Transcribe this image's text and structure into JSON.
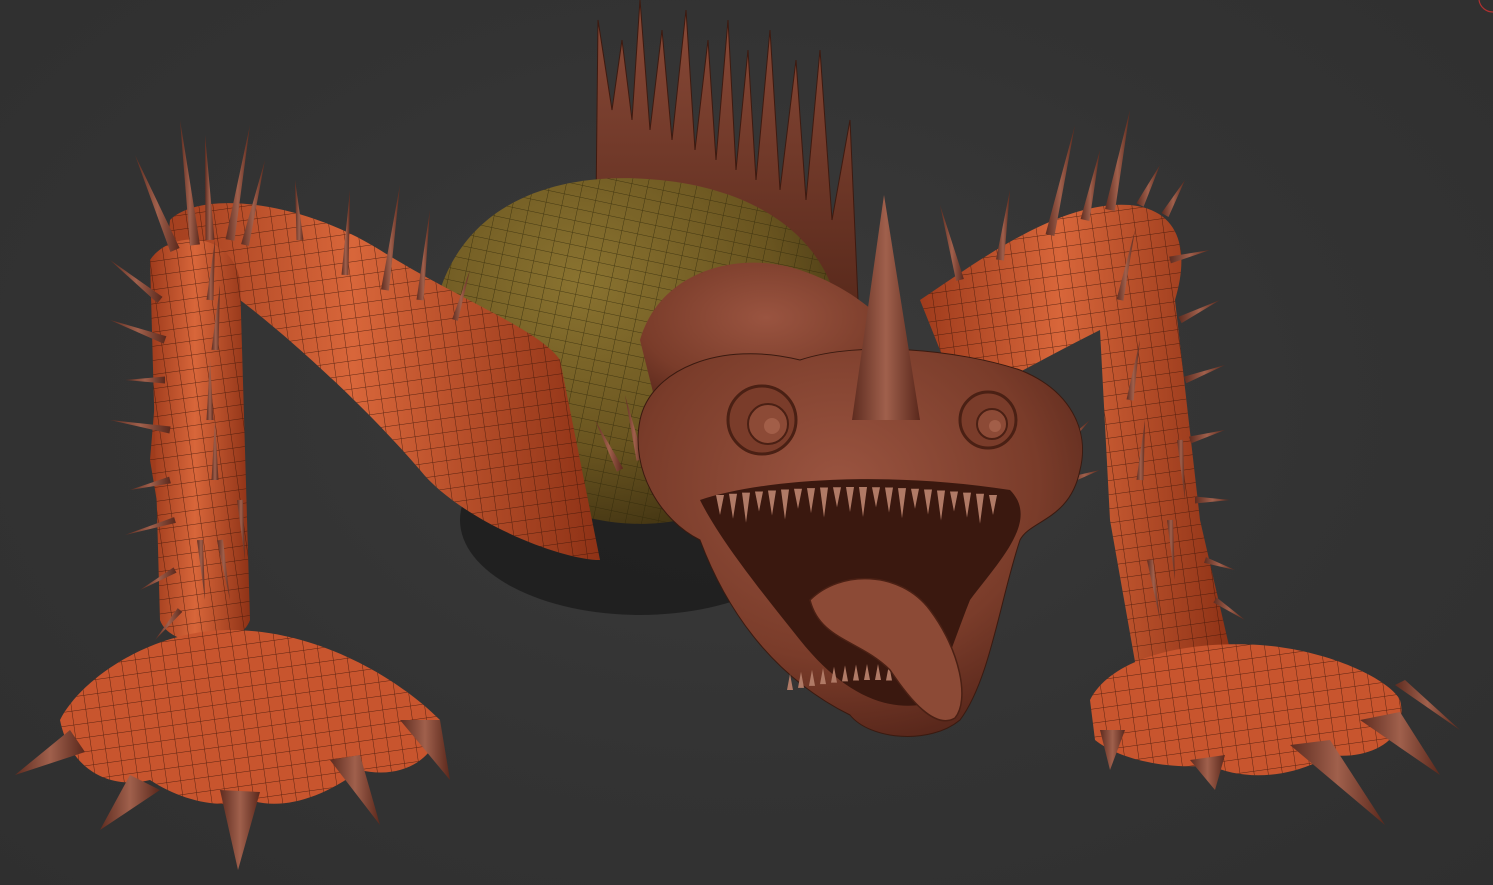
{
  "viewport": {
    "background": "#333333",
    "model": {
      "subject": "creature-sculpt",
      "subtool_colors": {
        "limbs": "#c8552e",
        "body": "#6f5a22",
        "head": "#7a3c2a",
        "spikes": "#7e4030",
        "polyframe": "#3a1408"
      }
    }
  },
  "icons": {
    "corner": "corner-arc-icon"
  }
}
